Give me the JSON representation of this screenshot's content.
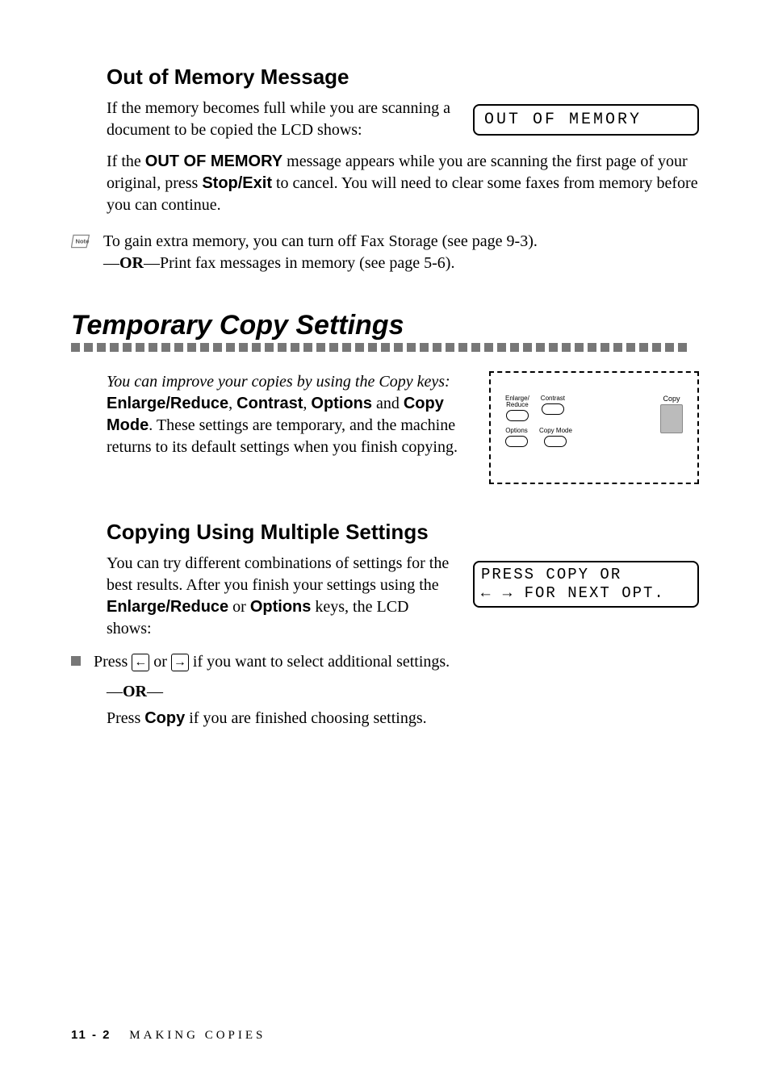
{
  "heading1": "Out of Memory Message",
  "para1": "If the memory becomes full while you are scanning a document to be copied the LCD shows:",
  "lcd1": "OUT OF MEMORY",
  "para2_pre": "If the ",
  "para2_bold1": "OUT OF MEMORY",
  "para2_mid": " message appears while you are scanning the first page of your original, press ",
  "para2_bold2": "Stop/Exit",
  "para2_end": " to cancel. You will need to clear some faxes from memory before you can continue.",
  "note_line1": "To gain extra memory, you can turn off Fax Storage (see page 9-3).",
  "note_or": "OR",
  "note_line2": "—Print fax messages in memory (see page 5-6).",
  "main_heading": "Temporary Copy Settings",
  "temp_italic": "You can improve your copies by using the Copy keys:",
  "temp_b1": "Enlarge/Reduce",
  "temp_b2": "Contrast",
  "temp_b3": "Options",
  "temp_and": " and ",
  "temp_b4": "Copy Mode",
  "temp_rest": ". These settings are temporary, and the machine returns to its default settings when you finish copying.",
  "panel_enlarge": "Enlarge/\nReduce",
  "panel_contrast": "Contrast",
  "panel_options": "Options",
  "panel_copymode": "Copy Mode",
  "panel_copy": "Copy",
  "heading2": "Copying Using Multiple Settings",
  "para3_a": "You can try different combinations of settings for the best results. After you finish your settings using the ",
  "para3_b1": "Enlarge/Reduce",
  "para3_mid": " or ",
  "para3_b2": "Options",
  "para3_end": " keys, the LCD shows:",
  "lcd2_l1": "PRESS COPY OR",
  "lcd2_l2": "← → FOR NEXT OPT.",
  "bullet1_a": "Press ",
  "bullet1_b": " or ",
  "bullet1_c": " if you want to select additional settings.",
  "or2": "OR",
  "para4_a": "Press ",
  "para4_b": "Copy",
  "para4_c": " if you are finished choosing settings.",
  "footer_page": "11 - 2",
  "footer_chapter": "MAKING COPIES"
}
